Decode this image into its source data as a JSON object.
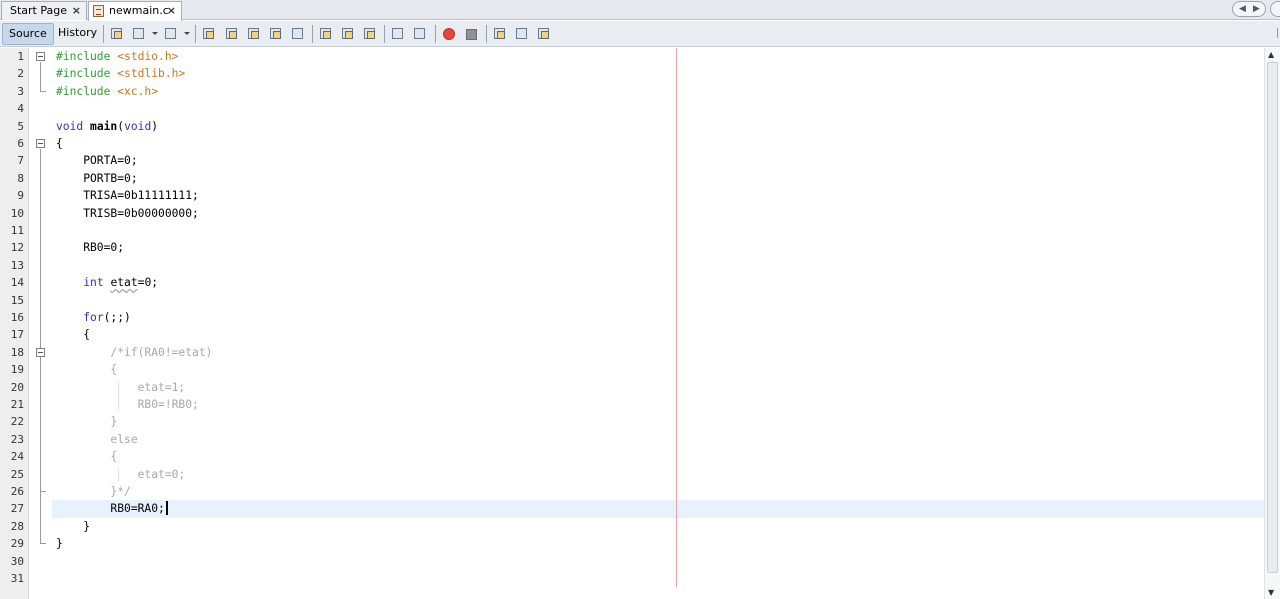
{
  "tabs": [
    {
      "label": "Start Page",
      "close": "×",
      "active": false
    },
    {
      "label": "newmain.c",
      "close": "×",
      "active": true
    }
  ],
  "toolbar": {
    "source_label": "Source",
    "history_label": "History",
    "icons": [
      "last-edit-icon",
      "back-icon",
      "forward-icon",
      "find-selection-icon",
      "find-previous-icon",
      "find-next-icon",
      "toggle-highlight-icon",
      "toggle-rectangular-selection-icon",
      "previous-bookmark-icon",
      "next-bookmark-icon",
      "toggle-bookmark-icon",
      "shift-left-icon",
      "shift-right-icon",
      "start-macro-recording-icon",
      "stop-macro-recording-icon",
      "comment-icon",
      "uncomment-icon",
      "diff-icon"
    ]
  },
  "editor": {
    "file": "newmain.c",
    "line_numbers": [
      "1",
      "2",
      "3",
      "4",
      "5",
      "6",
      "7",
      "8",
      "9",
      "10",
      "11",
      "12",
      "13",
      "14",
      "15",
      "16",
      "17",
      "18",
      "19",
      "20",
      "21",
      "22",
      "23",
      "24",
      "25",
      "26",
      "27",
      "28",
      "29",
      "30",
      "31"
    ],
    "current_line": 27,
    "lines": [
      [
        {
          "t": "#include ",
          "c": "pre"
        },
        {
          "t": "<stdio.h>",
          "c": "inc"
        }
      ],
      [
        {
          "t": "#include ",
          "c": "pre"
        },
        {
          "t": "<stdlib.h>",
          "c": "inc"
        }
      ],
      [
        {
          "t": "#include ",
          "c": "pre"
        },
        {
          "t": "<xc.h>",
          "c": "inc"
        }
      ],
      [],
      [
        {
          "t": "void",
          "c": "kw"
        },
        {
          "t": " "
        },
        {
          "t": "main",
          "c": "fn"
        },
        {
          "t": "("
        },
        {
          "t": "void",
          "c": "kw"
        },
        {
          "t": ")"
        }
      ],
      [
        {
          "t": "{"
        }
      ],
      [
        {
          "t": "    PORTA=0;"
        }
      ],
      [
        {
          "t": "    PORTB=0;"
        }
      ],
      [
        {
          "t": "    TRISA=0b11111111;"
        }
      ],
      [
        {
          "t": "    TRISB=0b00000000;"
        }
      ],
      [],
      [
        {
          "t": "    RB0=0;"
        }
      ],
      [],
      [
        {
          "t": "    "
        },
        {
          "t": "int",
          "c": "kw"
        },
        {
          "t": " "
        },
        {
          "t": "etat",
          "c": "sq"
        },
        {
          "t": "=0;"
        }
      ],
      [],
      [
        {
          "t": "    "
        },
        {
          "t": "for",
          "c": "kw"
        },
        {
          "t": "(;;)"
        }
      ],
      [
        {
          "t": "    {"
        }
      ],
      [
        {
          "t": "        /*if(RA0!=etat)",
          "c": "cmt"
        }
      ],
      [
        {
          "t": "        {",
          "c": "cmt"
        }
      ],
      [
        {
          "t": "            etat=1;",
          "c": "cmt"
        }
      ],
      [
        {
          "t": "            RB0=!RB0;",
          "c": "cmt"
        }
      ],
      [
        {
          "t": "        }",
          "c": "cmt"
        }
      ],
      [
        {
          "t": "        else",
          "c": "cmt"
        }
      ],
      [
        {
          "t": "        {",
          "c": "cmt"
        }
      ],
      [
        {
          "t": "            etat=0;",
          "c": "cmt"
        }
      ],
      [
        {
          "t": "        }*/",
          "c": "cmt"
        }
      ],
      [
        {
          "t": "        RB0=RA0;"
        },
        {
          "t": "",
          "c": "caret"
        }
      ],
      [
        {
          "t": "    }"
        }
      ],
      [
        {
          "t": "}"
        }
      ],
      [],
      []
    ]
  },
  "colors": {
    "preprocessor": "#2f9e2f",
    "include_path": "#c9761c",
    "keyword": "#2f2fcf",
    "comment": "#a8a8a8",
    "current_line_bg": "#e8f2fe",
    "right_margin": "#f0a0a0"
  }
}
